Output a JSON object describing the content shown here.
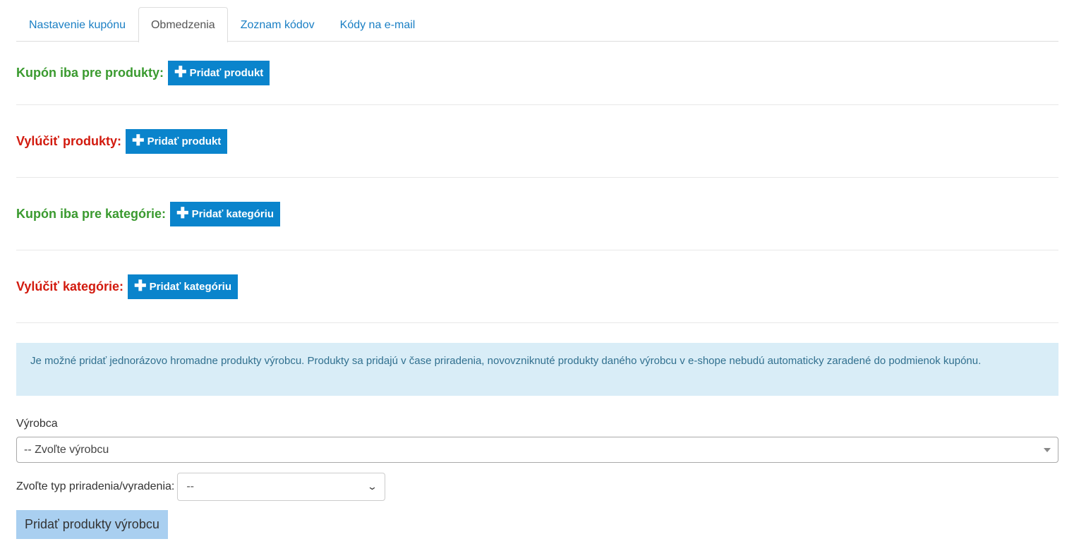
{
  "tabs": [
    {
      "label": "Nastavenie kupónu",
      "active": false
    },
    {
      "label": "Obmedzenia",
      "active": true
    },
    {
      "label": "Zoznam kódov",
      "active": false
    },
    {
      "label": "Kódy na e-mail",
      "active": false
    }
  ],
  "sections": [
    {
      "label": "Kupón iba pre produkty:",
      "color": "#3a9a2f",
      "button": "Pridať produkt"
    },
    {
      "label": "Vylúčiť produkty:",
      "color": "#d21a0e",
      "button": "Pridať produkt"
    },
    {
      "label": "Kupón iba pre kategórie:",
      "color": "#3a9a2f",
      "button": "Pridať kategóriu"
    },
    {
      "label": "Vylúčiť kategórie:",
      "color": "#d21a0e",
      "button": "Pridať kategóriu"
    }
  ],
  "info": {
    "text": "Je možné pridať jednorázovo hromadne produkty výrobcu. Produkty sa pridajú v čase priradenia, novovzniknuté produkty daného výrobcu v e-shope nebudú automaticky zaradené do podmienok kupónu."
  },
  "manufacturer": {
    "label": "Výrobca",
    "selected": "-- Zvoľte výrobcu"
  },
  "assignment": {
    "label": "Zvoľte typ priradenia/vyradenia:",
    "selected": "--"
  },
  "submit_label": "Pridať produkty výrobcu",
  "colors": {
    "accent": "#0a84cc",
    "link": "#1a7fc4",
    "info_bg": "#d9edf7"
  }
}
